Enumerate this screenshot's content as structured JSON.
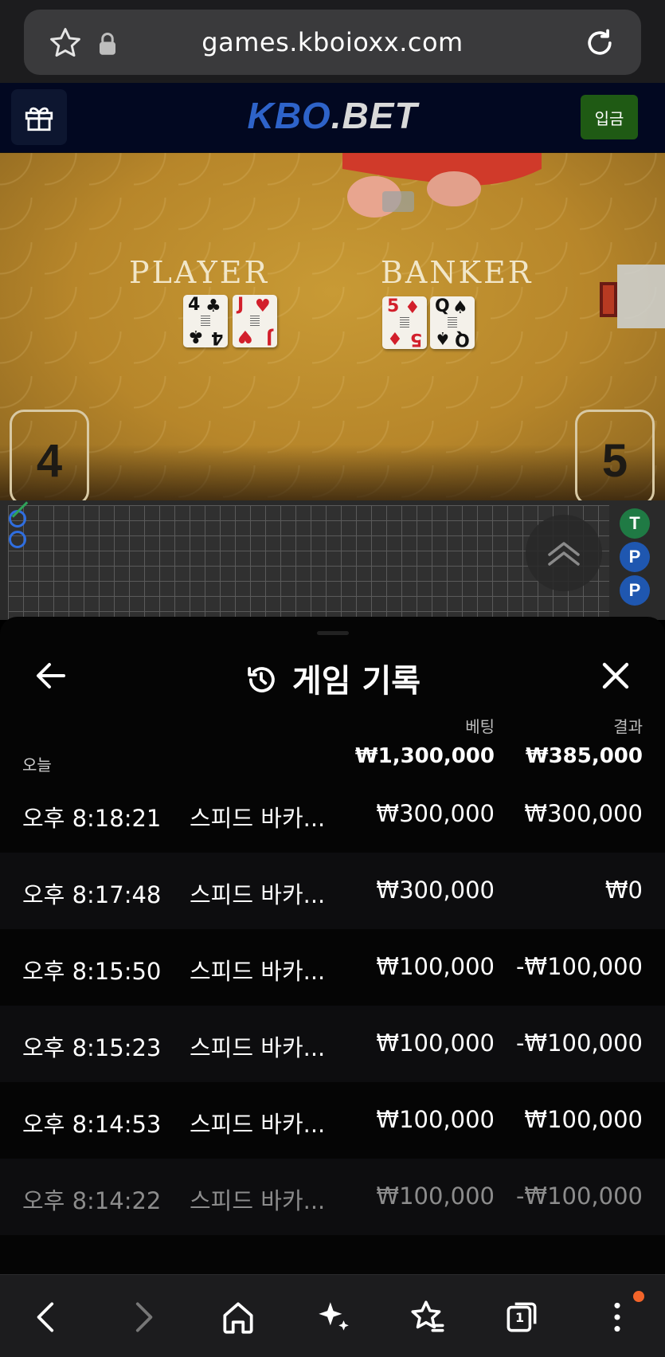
{
  "browser": {
    "url": "games.kboioxx.com",
    "icons": [
      "star-icon",
      "lock-icon",
      "reload-icon"
    ]
  },
  "site": {
    "logo_main": "KBO",
    "logo_rest": ".BET",
    "deposit_label": "입금",
    "colors": {
      "logo_blue": "#2e63c9",
      "deposit_green": "#1f5a14"
    }
  },
  "game": {
    "player_label": "PLAYER",
    "banker_label": "BANKER",
    "player_cards": [
      {
        "rank": "4",
        "suit": "♣",
        "color": "blk"
      },
      {
        "rank": "J",
        "suit": "♥",
        "color": "red"
      }
    ],
    "banker_cards": [
      {
        "rank": "5",
        "suit": "♦",
        "color": "red"
      },
      {
        "rank": "Q",
        "suit": "♠",
        "color": "blk"
      }
    ],
    "player_score": "4",
    "banker_score": "5"
  },
  "roadmap": {
    "beads": [
      "T",
      "P",
      "P"
    ]
  },
  "history": {
    "title": "게임 기록",
    "col_bet": "베팅",
    "col_result": "결과",
    "today_label": "오늘",
    "total_bet": "₩1,300,000",
    "total_result": "₩385,000",
    "rows": [
      {
        "time": "오후 8:18:21",
        "game": "스피드 바카...",
        "bet": "₩300,000",
        "result": "₩300,000"
      },
      {
        "time": "오후 8:17:48",
        "game": "스피드 바카...",
        "bet": "₩300,000",
        "result": "₩0"
      },
      {
        "time": "오후 8:15:50",
        "game": "스피드 바카...",
        "bet": "₩100,000",
        "result": "-₩100,000"
      },
      {
        "time": "오후 8:15:23",
        "game": "스피드 바카...",
        "bet": "₩100,000",
        "result": "-₩100,000"
      },
      {
        "time": "오후 8:14:53",
        "game": "스피드 바카...",
        "bet": "₩100,000",
        "result": "₩100,000"
      },
      {
        "time": "오후 8:14:22",
        "game": "스피드 바카...",
        "bet": "₩100,000",
        "result": "-₩100,000"
      }
    ]
  },
  "bottom_nav": {
    "tabs_count": "1",
    "icons": [
      "back-icon",
      "forward-icon",
      "home-icon",
      "sparkle-icon",
      "bookmark-star-icon",
      "tabs-icon",
      "more-icon"
    ]
  }
}
